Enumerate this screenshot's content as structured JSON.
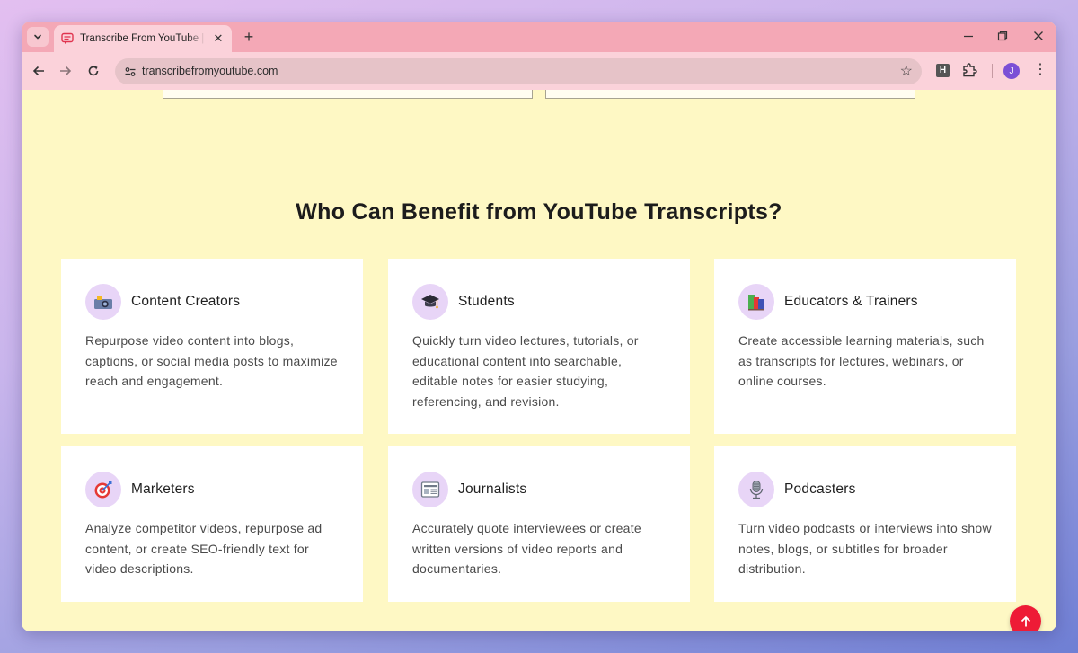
{
  "browser": {
    "tab_title": "Transcribe From YouTube | Quick",
    "url": "transcribefromyoutube.com",
    "profile_initial": "J",
    "extension_label": "H"
  },
  "section": {
    "title": "Who Can Benefit from YouTube Transcripts?"
  },
  "cards": [
    {
      "title": "Content Creators",
      "description": "Repurpose video content into blogs, captions, or social media posts to maximize reach and engagement.",
      "icon": "camera-icon"
    },
    {
      "title": "Students",
      "description": "Quickly turn video lectures, tutorials, or educational content into searchable, editable notes for easier studying, referencing, and revision.",
      "icon": "graduation-cap-icon"
    },
    {
      "title": "Educators & Trainers",
      "description": "Create accessible learning materials, such as transcripts for lectures, webinars, or online courses.",
      "icon": "books-icon"
    },
    {
      "title": "Marketers",
      "description": "Analyze competitor videos, repurpose ad content, or create SEO-friendly text for video descriptions.",
      "icon": "target-icon"
    },
    {
      "title": "Journalists",
      "description": "Accurately quote interviewees or create written versions of video reports and documentaries.",
      "icon": "newspaper-icon"
    },
    {
      "title": "Podcasters",
      "description": "Turn video podcasts or interviews into show notes, blogs, or subtitles for broader distribution.",
      "icon": "microphone-icon"
    }
  ],
  "colors": {
    "page_background": "#fef8c4",
    "tab_strip": "#f4a8b6",
    "toolbar": "#fbd2da",
    "icon_circle": "#e8d5f7",
    "scroll_top_button": "#ee1b36"
  }
}
